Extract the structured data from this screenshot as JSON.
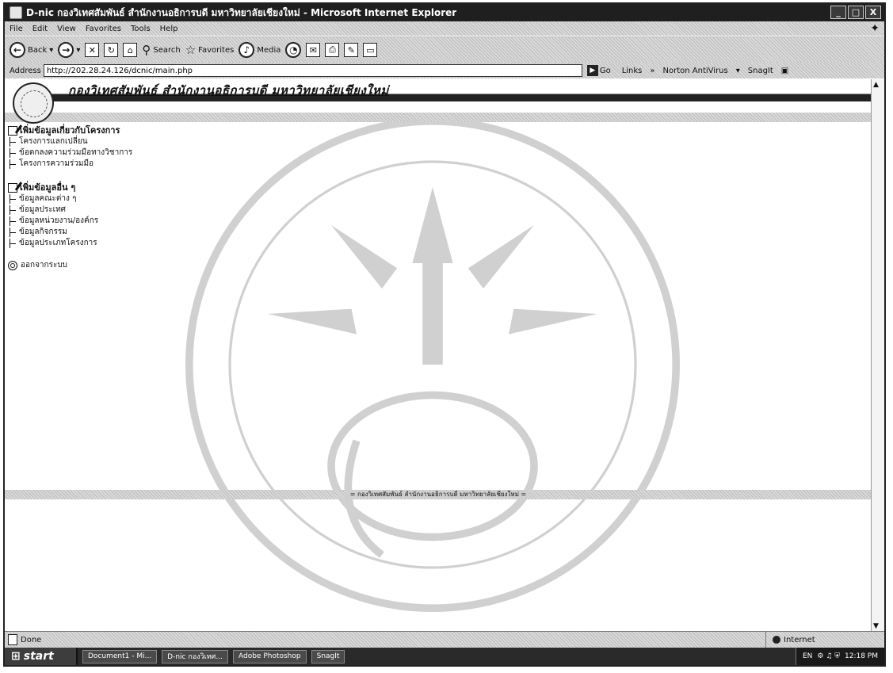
{
  "window": {
    "title": "D-nic กองวิเทศสัมพันธ์ สำนักงานอธิการบดี มหาวิทยาลัยเชียงใหม่ - Microsoft Internet Explorer",
    "buttons": [
      "_",
      "□",
      "X"
    ]
  },
  "menu": [
    "File",
    "Edit",
    "View",
    "Favorites",
    "Tools",
    "Help"
  ],
  "toolbar": {
    "back": "Back",
    "search": "Search",
    "favorites": "Favorites",
    "media": "Media"
  },
  "address": {
    "label": "Address",
    "url": "http://202.28.24.126/dcnic/main.php",
    "go": "Go",
    "links": "Links",
    "chevron": "»",
    "norton": "Norton AntiVirus",
    "snagit": "SnagIt"
  },
  "banner": {
    "title": "กองวิเทศสัมพันธ์ สำนักงานอธิการบดี มหาวิทยาลัยเชียงใหม่"
  },
  "nav": {
    "section1": {
      "title": "เพิ่มข้อมูลเกี่ยวกับโครงการ",
      "items": [
        "โครงการแลกเปลี่ยน",
        "ข้อตกลงความร่วมมือทางวิชาการ",
        "โครงการความร่วมมือ"
      ]
    },
    "section2": {
      "title": "เพิ่มข้อมูลอื่น ๆ",
      "items": [
        "ข้อมูลคณะต่าง ๆ",
        "ข้อมูลประเทศ",
        "ข้อมูลหน่วยงาน/องค์กร",
        "ข้อมูลกิจกรรม",
        "ข้อมูลประเภทโครงการ"
      ]
    },
    "logout": "ออกจากระบบ"
  },
  "footer": {
    "text": "= กองวิเทศสัมพันธ์ สำนักงานอธิการบดี มหาวิทยาลัยเชียงใหม่ ="
  },
  "status": {
    "text": "Done",
    "zone": "Internet"
  },
  "taskbar": {
    "start": "start",
    "items": [
      "Document1 - Mi...",
      "D-nic กองวิเทศ...",
      "Adobe Photoshop",
      "SnagIt"
    ],
    "tray_lang": "EN",
    "clock": "12:18 PM"
  }
}
